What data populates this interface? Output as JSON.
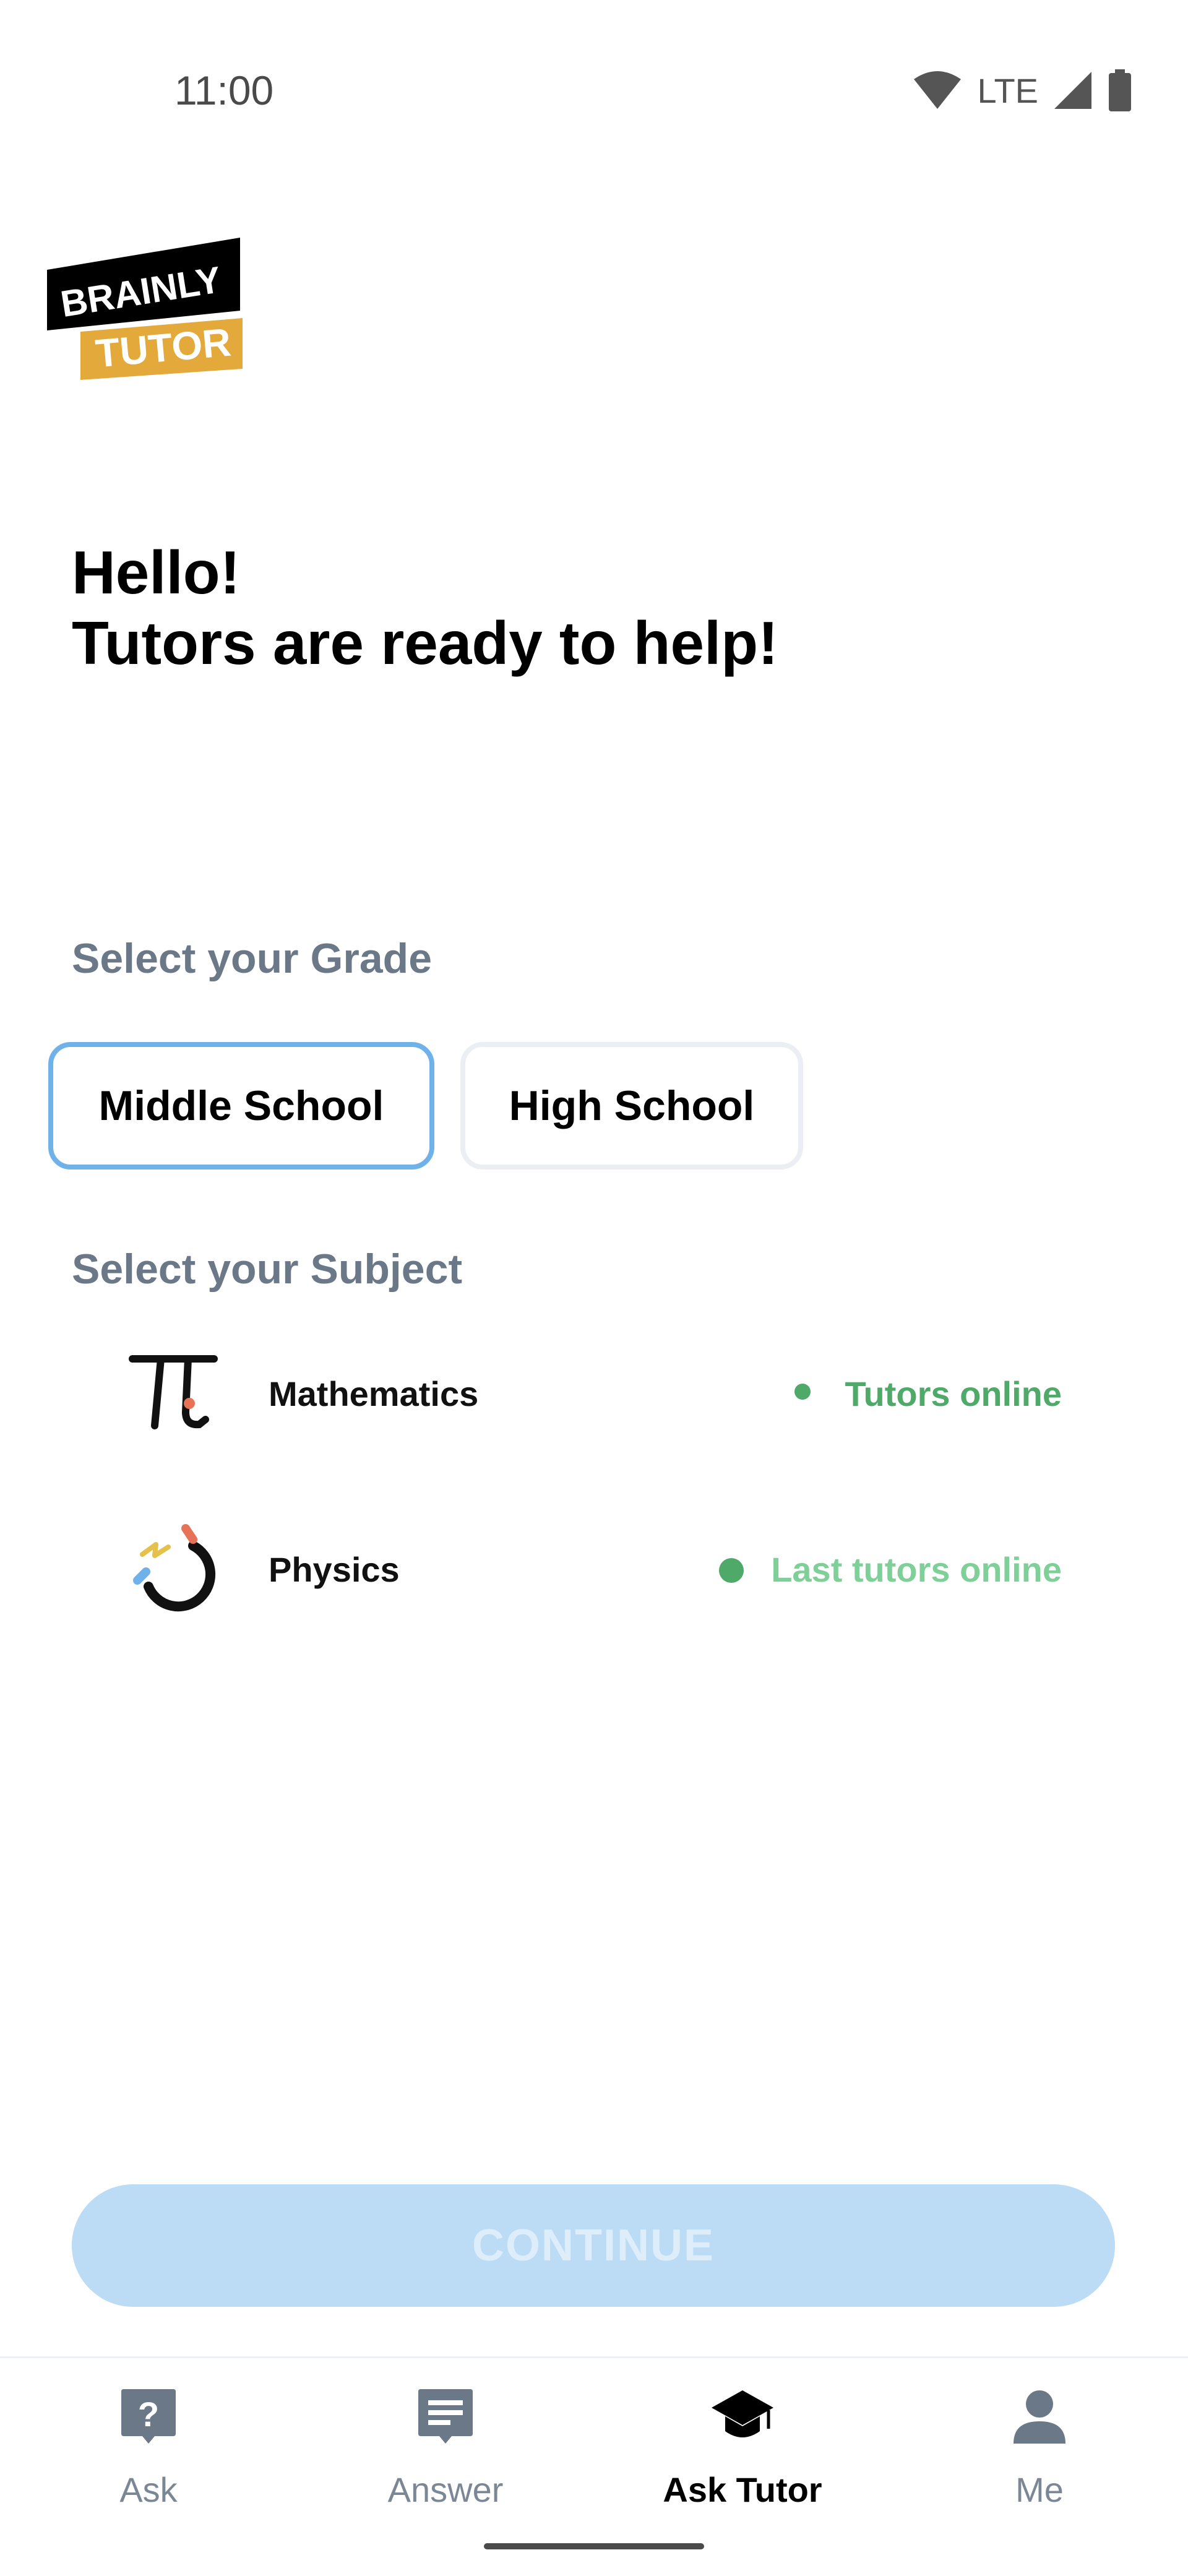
{
  "status_bar": {
    "time": "11:00",
    "network": "LTE"
  },
  "logo": {
    "line1": "BRAINLY",
    "line2": "TUTOR"
  },
  "greeting": {
    "line1": "Hello!",
    "line2": "Tutors are ready to help!"
  },
  "grade": {
    "title": "Select your Grade",
    "options": [
      {
        "label": "Middle School",
        "selected": true
      },
      {
        "label": "High School",
        "selected": false
      }
    ]
  },
  "subject": {
    "title": "Select your Subject",
    "items": [
      {
        "name": "Mathematics",
        "status": "Tutors online",
        "icon": "pi-icon",
        "status_color": "#4faa6a"
      },
      {
        "name": "Physics",
        "status": "Last tutors online",
        "icon": "magnet-icon",
        "status_color": "#7fcf98"
      }
    ]
  },
  "continue_label": "CONTINUE",
  "nav": {
    "items": [
      {
        "label": "Ask",
        "icon": "question-icon",
        "active": false
      },
      {
        "label": "Answer",
        "icon": "answer-icon",
        "active": false
      },
      {
        "label": "Ask Tutor",
        "icon": "graduation-cap-icon",
        "active": true
      },
      {
        "label": "Me",
        "icon": "person-icon",
        "active": false
      }
    ]
  },
  "colors": {
    "accent_blue": "#6fb2ea",
    "continue_disabled": "#bcdcf6",
    "online_green": "#4faa6a",
    "logo_yellow": "#e3a93b"
  }
}
